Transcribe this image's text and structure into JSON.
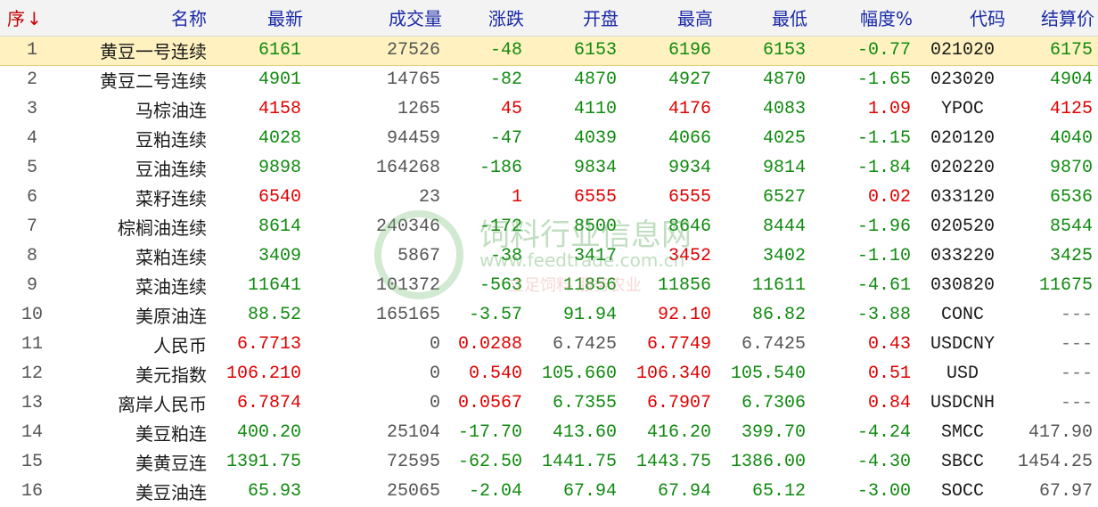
{
  "header": {
    "seq": "序",
    "seq_arrow": "↓",
    "name": "名称",
    "latest": "最新",
    "volume": "成交量",
    "change": "涨跌",
    "open": "开盘",
    "high": "最高",
    "low": "最低",
    "pct": "幅度%",
    "code": "代码",
    "settle": "结算价"
  },
  "rows": [
    {
      "seq": "1",
      "name": "黄豆一号连续",
      "latest": "6161",
      "volume": "27526",
      "change": "-48",
      "open": "6153",
      "high": "6196",
      "low": "6153",
      "pct": "-0.77",
      "code": "021020",
      "settle": "6175",
      "selected": true,
      "colors": {
        "latest": "down",
        "change": "down",
        "open": "down",
        "high": "down",
        "low": "down",
        "pct": "down",
        "settle": "down"
      }
    },
    {
      "seq": "2",
      "name": "黄豆二号连续",
      "latest": "4901",
      "volume": "14765",
      "change": "-82",
      "open": "4870",
      "high": "4927",
      "low": "4870",
      "pct": "-1.65",
      "code": "023020",
      "settle": "4904",
      "colors": {
        "latest": "down",
        "change": "down",
        "open": "down",
        "high": "down",
        "low": "down",
        "pct": "down",
        "settle": "down"
      }
    },
    {
      "seq": "3",
      "name": "马棕油连",
      "latest": "4158",
      "volume": "1265",
      "change": "45",
      "open": "4110",
      "high": "4176",
      "low": "4083",
      "pct": "1.09",
      "code": "YPOC",
      "settle": "4125",
      "colors": {
        "latest": "up",
        "change": "up",
        "open": "down",
        "high": "up",
        "low": "down",
        "pct": "up",
        "settle": "up"
      }
    },
    {
      "seq": "4",
      "name": "豆粕连续",
      "latest": "4028",
      "volume": "94459",
      "change": "-47",
      "open": "4039",
      "high": "4066",
      "low": "4025",
      "pct": "-1.15",
      "code": "020120",
      "settle": "4040",
      "colors": {
        "latest": "down",
        "change": "down",
        "open": "down",
        "high": "down",
        "low": "down",
        "pct": "down",
        "settle": "down"
      }
    },
    {
      "seq": "5",
      "name": "豆油连续",
      "latest": "9898",
      "volume": "164268",
      "change": "-186",
      "open": "9834",
      "high": "9934",
      "low": "9814",
      "pct": "-1.84",
      "code": "020220",
      "settle": "9870",
      "colors": {
        "latest": "down",
        "change": "down",
        "open": "down",
        "high": "down",
        "low": "down",
        "pct": "down",
        "settle": "down"
      }
    },
    {
      "seq": "6",
      "name": "菜籽连续",
      "latest": "6540",
      "volume": "23",
      "change": "1",
      "open": "6555",
      "high": "6555",
      "low": "6527",
      "pct": "0.02",
      "code": "033120",
      "settle": "6536",
      "colors": {
        "latest": "up",
        "change": "up",
        "open": "up",
        "high": "up",
        "low": "down",
        "pct": "up",
        "settle": "down"
      }
    },
    {
      "seq": "7",
      "name": "棕榈油连续",
      "latest": "8614",
      "volume": "240346",
      "change": "-172",
      "open": "8500",
      "high": "8646",
      "low": "8444",
      "pct": "-1.96",
      "code": "020520",
      "settle": "8544",
      "colors": {
        "latest": "down",
        "change": "down",
        "open": "down",
        "high": "down",
        "low": "down",
        "pct": "down",
        "settle": "down"
      }
    },
    {
      "seq": "8",
      "name": "菜粕连续",
      "latest": "3409",
      "volume": "5867",
      "change": "-38",
      "open": "3417",
      "high": "3452",
      "low": "3402",
      "pct": "-1.10",
      "code": "033220",
      "settle": "3425",
      "colors": {
        "latest": "down",
        "change": "down",
        "open": "down",
        "high": "up",
        "low": "down",
        "pct": "down",
        "settle": "down"
      }
    },
    {
      "seq": "9",
      "name": "菜油连续",
      "latest": "11641",
      "volume": "101372",
      "change": "-563",
      "open": "11856",
      "high": "11856",
      "low": "11611",
      "pct": "-4.61",
      "code": "030820",
      "settle": "11675",
      "colors": {
        "latest": "down",
        "change": "down",
        "open": "down",
        "high": "down",
        "low": "down",
        "pct": "down",
        "settle": "down"
      }
    },
    {
      "seq": "10",
      "name": "美原油连",
      "latest": "88.52",
      "volume": "165165",
      "change": "-3.57",
      "open": "91.94",
      "high": "92.10",
      "low": "86.82",
      "pct": "-3.88",
      "code": "CONC",
      "settle": "---",
      "colors": {
        "latest": "down",
        "change": "down",
        "open": "down",
        "high": "up",
        "low": "down",
        "pct": "down",
        "settle": "na"
      }
    },
    {
      "seq": "11",
      "name": "人民币",
      "latest": "6.7713",
      "volume": "0",
      "change": "0.0288",
      "open": "6.7425",
      "high": "6.7749",
      "low": "6.7425",
      "pct": "0.43",
      "code": "USDCNY",
      "settle": "---",
      "colors": {
        "latest": "up",
        "change": "up",
        "open": "flat",
        "high": "up",
        "low": "flat",
        "pct": "up",
        "settle": "na"
      }
    },
    {
      "seq": "12",
      "name": "美元指数",
      "latest": "106.210",
      "volume": "0",
      "change": "0.540",
      "open": "105.660",
      "high": "106.340",
      "low": "105.540",
      "pct": "0.51",
      "code": "USD",
      "settle": "---",
      "colors": {
        "latest": "up",
        "change": "up",
        "open": "down",
        "high": "up",
        "low": "down",
        "pct": "up",
        "settle": "na"
      }
    },
    {
      "seq": "13",
      "name": "离岸人民币",
      "latest": "6.7874",
      "volume": "0",
      "change": "0.0567",
      "open": "6.7355",
      "high": "6.7907",
      "low": "6.7306",
      "pct": "0.84",
      "code": "USDCNH",
      "settle": "---",
      "colors": {
        "latest": "up",
        "change": "up",
        "open": "down",
        "high": "up",
        "low": "down",
        "pct": "up",
        "settle": "na"
      }
    },
    {
      "seq": "14",
      "name": "美豆粕连",
      "latest": "400.20",
      "volume": "25104",
      "change": "-17.70",
      "open": "413.60",
      "high": "416.20",
      "low": "399.70",
      "pct": "-4.24",
      "code": "SMCC",
      "settle": "417.90",
      "colors": {
        "latest": "down",
        "change": "down",
        "open": "down",
        "high": "down",
        "low": "down",
        "pct": "down",
        "settle": "flat"
      }
    },
    {
      "seq": "15",
      "name": "美黄豆连",
      "latest": "1391.75",
      "volume": "72595",
      "change": "-62.50",
      "open": "1441.75",
      "high": "1443.75",
      "low": "1386.00",
      "pct": "-4.30",
      "code": "SBCC",
      "settle": "1454.25",
      "colors": {
        "latest": "down",
        "change": "down",
        "open": "down",
        "high": "down",
        "low": "down",
        "pct": "down",
        "settle": "flat"
      }
    },
    {
      "seq": "16",
      "name": "美豆油连",
      "latest": "65.93",
      "volume": "25065",
      "change": "-2.04",
      "open": "67.94",
      "high": "67.94",
      "low": "65.12",
      "pct": "-3.00",
      "code": "SOCC",
      "settle": "67.97",
      "colors": {
        "latest": "down",
        "change": "down",
        "open": "down",
        "high": "down",
        "low": "down",
        "pct": "down",
        "settle": "flat"
      }
    }
  ],
  "watermark": {
    "title": "饲料行业信息网",
    "url": "www.feedtrade.com.cn",
    "slogan": "立足饲料 服务农业"
  },
  "colors": {
    "up": "#e00000",
    "down": "#0f8a0f",
    "header_text": "#1a2aa8",
    "selected_row": "#fff2c0"
  }
}
